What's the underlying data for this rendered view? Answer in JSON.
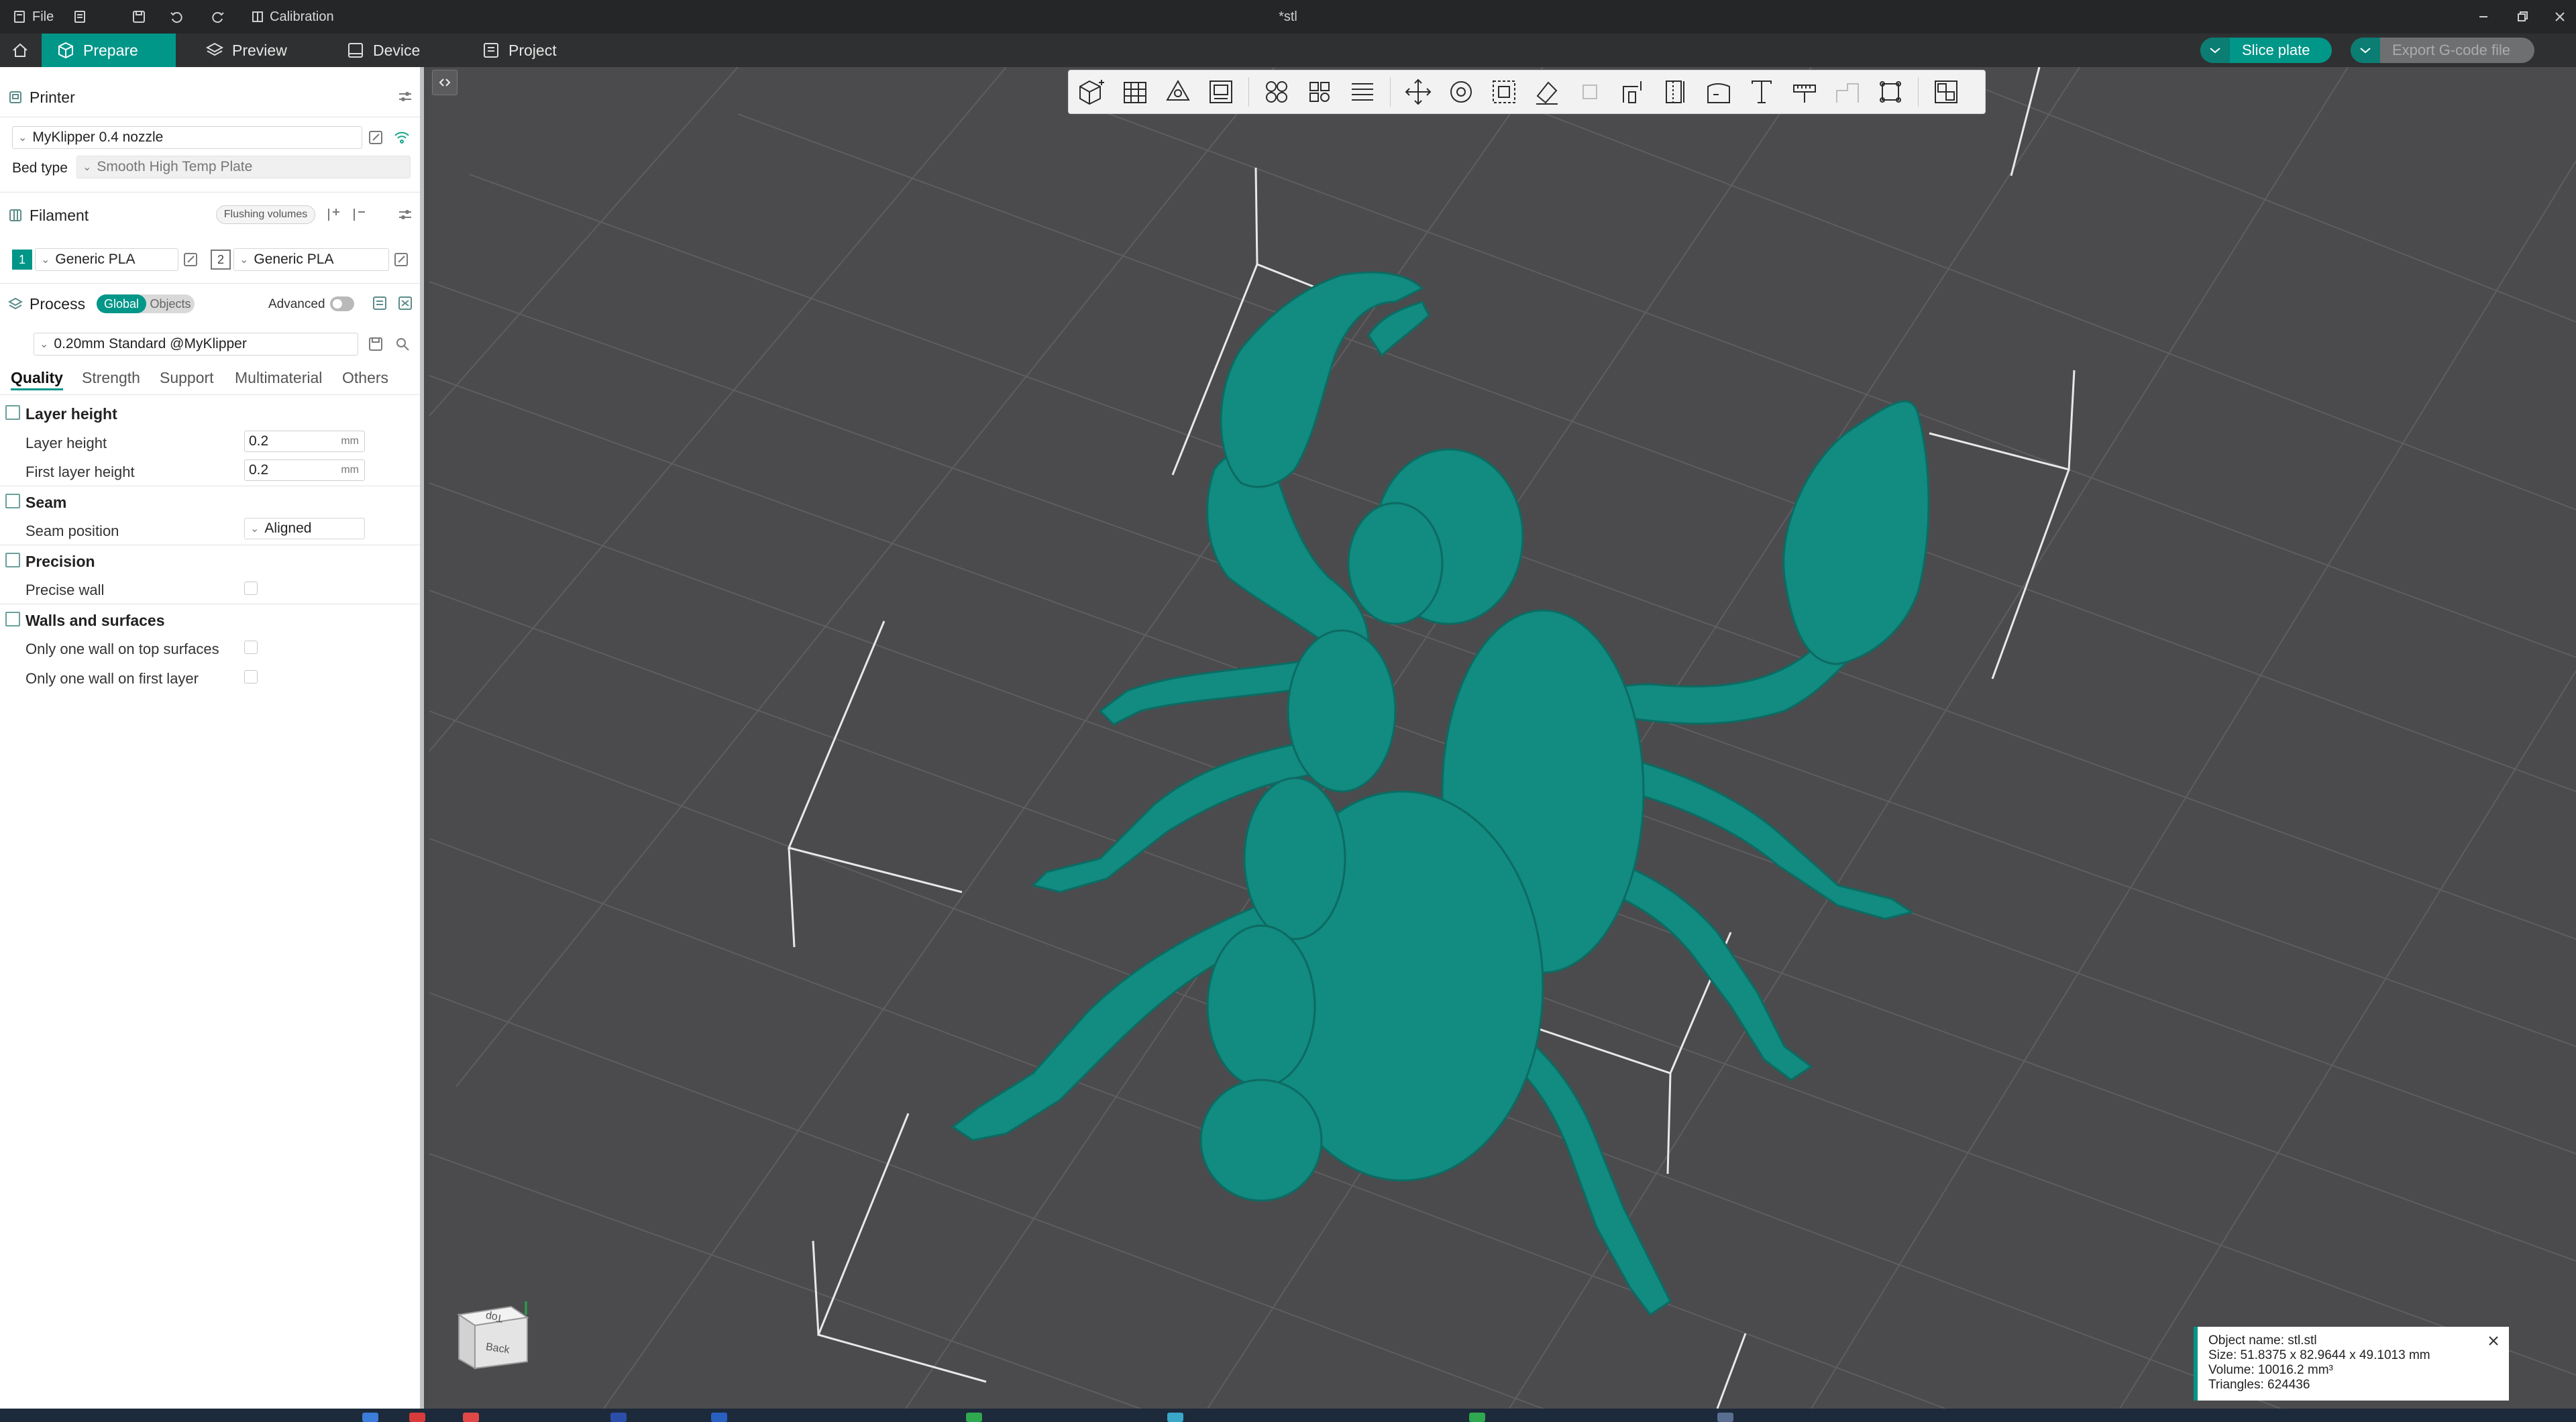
{
  "titlebar": {
    "file_label": "File",
    "calibration_label": "Calibration",
    "doc_title": "*stl"
  },
  "tabs": [
    {
      "label": "Prepare",
      "icon": "cube-icon"
    },
    {
      "label": "Preview",
      "icon": "layers-icon"
    },
    {
      "label": "Device",
      "icon": "device-icon"
    },
    {
      "label": "Project",
      "icon": "project-icon"
    }
  ],
  "actions": {
    "slice_label": "Slice plate",
    "export_label": "Export G-code file"
  },
  "colors": {
    "accent": "#009688",
    "model": "#138f85"
  },
  "printer": {
    "section_title": "Printer",
    "name": "MyKlipper 0.4 nozzle",
    "bed_type_label": "Bed type",
    "bed_type_value": "Smooth High Temp Plate"
  },
  "filament": {
    "section_title": "Filament",
    "flushing_label": "Flushing volumes",
    "slots": [
      {
        "index": "1",
        "name": "Generic PLA"
      },
      {
        "index": "2",
        "name": "Generic PLA"
      }
    ]
  },
  "process": {
    "section_title": "Process",
    "global_label": "Global",
    "objects_label": "Objects",
    "advanced_label": "Advanced",
    "preset": "0.20mm Standard @MyKlipper",
    "tabs": [
      "Quality",
      "Strength",
      "Support",
      "Multimaterial",
      "Others"
    ],
    "groups": {
      "layer_height": {
        "title": "Layer height",
        "layer_height_label": "Layer height",
        "layer_height_value": "0.2",
        "first_layer_label": "First layer height",
        "first_layer_value": "0.2",
        "unit": "mm"
      },
      "seam": {
        "title": "Seam",
        "position_label": "Seam position",
        "position_value": "Aligned"
      },
      "precision": {
        "title": "Precision",
        "precise_wall_label": "Precise wall"
      },
      "walls": {
        "title": "Walls and surfaces",
        "top_label": "Only one wall on top surfaces",
        "first_label": "Only one wall on first layer"
      }
    }
  },
  "viewcube": {
    "top": "Top",
    "back": "Back"
  },
  "object_info": {
    "name": "Object name: stl.stl",
    "size": "Size: 51.8375 x 82.9644 x 49.1013 mm",
    "volume": "Volume: 10016.2 mm³",
    "triangles": "Triangles: 624436"
  }
}
